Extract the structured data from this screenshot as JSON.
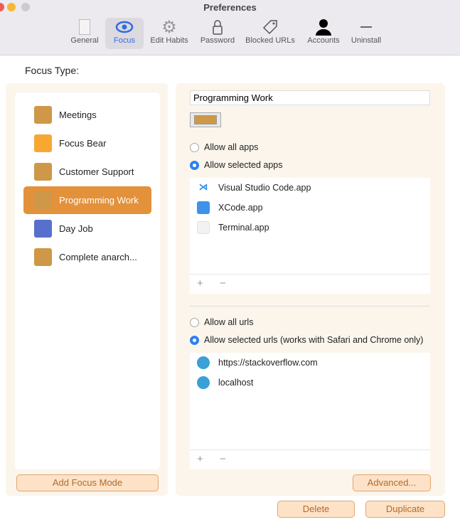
{
  "window": {
    "title": "Preferences"
  },
  "toolbar": [
    {
      "label": "General",
      "icon": "switch-icon"
    },
    {
      "label": "Focus",
      "icon": "eye-icon"
    },
    {
      "label": "Edit Habits",
      "icon": "gear-icon"
    },
    {
      "label": "Password",
      "icon": "lock-icon"
    },
    {
      "label": "Blocked URLs",
      "icon": "tag-icon"
    },
    {
      "label": "Accounts",
      "icon": "person-icon"
    },
    {
      "label": "Uninstall",
      "icon": "minus-icon"
    }
  ],
  "focus_type_label": "Focus Type:",
  "focus_modes": [
    {
      "label": "Meetings",
      "color": "#cf9748"
    },
    {
      "label": "Focus Bear",
      "color": "#f9a733"
    },
    {
      "label": "Customer Support",
      "color": "#cf9748"
    },
    {
      "label": "Programming Work",
      "color": "#cf9748",
      "selected": true
    },
    {
      "label": "Day Job",
      "color": "#5670cc"
    },
    {
      "label": "Complete anarch...",
      "color": "#cf9748"
    }
  ],
  "add_focus_mode": "Add Focus Mode",
  "detail": {
    "name": "Programming Work",
    "color": "#cf9748",
    "apps_options": [
      "Allow all apps",
      "Allow selected apps"
    ],
    "apps": [
      "Visual Studio Code.app",
      "XCode.app",
      "Terminal.app"
    ],
    "urls_options": [
      "Allow all urls",
      "Allow selected urls (works with Safari and Chrome only)"
    ],
    "urls": [
      "https://stackoverflow.com",
      "localhost"
    ],
    "add": "+",
    "remove": "−",
    "advanced": "Advanced..."
  },
  "delete": "Delete",
  "duplicate": "Duplicate"
}
